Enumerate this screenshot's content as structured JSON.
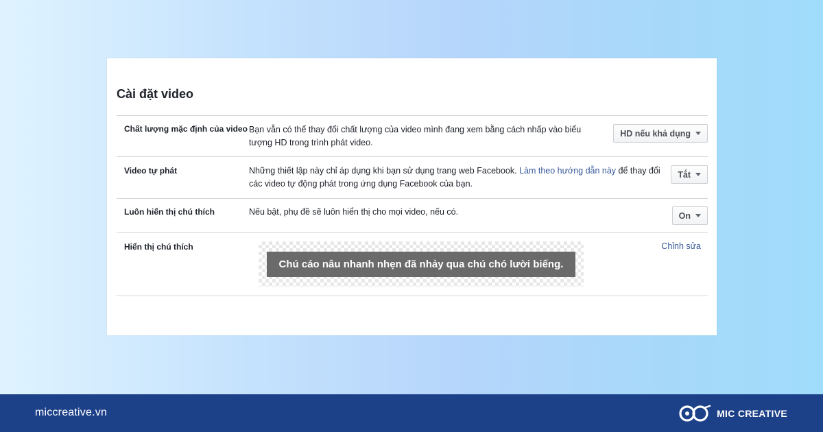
{
  "settings": {
    "title": "Cài đặt video",
    "rows": [
      {
        "label": "Chất lượng mặc định của video",
        "description": "Bạn vẫn có thể thay đổi chất lượng của video mình đang xem bằng cách nhấp vào biểu tượng HD trong trình phát video.",
        "dropdown_value": "HD nếu khả dụng"
      },
      {
        "label": "Video tự phát",
        "description": "Những thiết lập này chỉ áp dụng khi bạn sử dụng trang web Facebook.",
        "link_text": "Làm theo hướng dẫn này",
        "description_after_link": "để thay đổi các video tự động phát trong ứng dụng Facebook của bạn.",
        "dropdown_value": "Tắt"
      },
      {
        "label": "Luôn hiển thị chú thích",
        "description": "Nếu bật, phụ đề sẽ luôn hiển thị cho mọi video, nếu có.",
        "dropdown_value": "On"
      },
      {
        "label": "Hiển thị chú thích",
        "caption_sample": "Chú cáo nâu nhanh nhẹn đã nhảy qua chú chó lười biếng.",
        "edit_label": "Chỉnh sửa"
      }
    ]
  },
  "footer": {
    "website": "miccreative.vn",
    "brand": "MIC CREATIVE",
    "background_color": "#1d4189"
  }
}
